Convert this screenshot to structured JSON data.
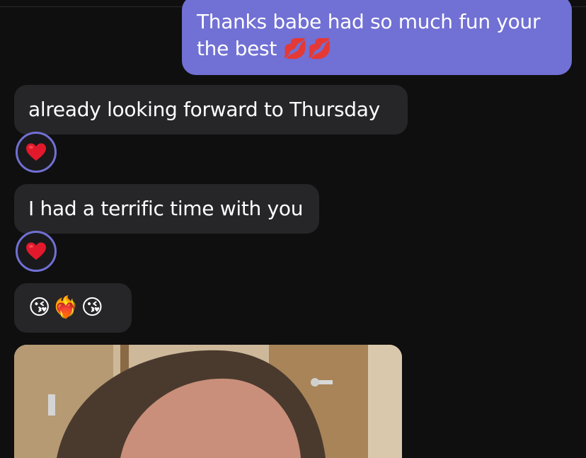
{
  "messages": {
    "outgoing_1": {
      "text": "Thanks babe had so much fun your the best 💋💋"
    },
    "incoming_1": {
      "text": "already looking forward to Thursday",
      "reaction": "heart"
    },
    "incoming_2": {
      "text": "I had a terrific time with you",
      "reaction": "heart"
    },
    "incoming_3": {
      "text": "😘❤️‍🔥😘"
    }
  },
  "colors": {
    "background": "#0f0f10",
    "outgoing_bubble": "#7170d4",
    "incoming_bubble": "#262628",
    "reaction_ring": "#7170d4",
    "heart": "#e2192c"
  }
}
